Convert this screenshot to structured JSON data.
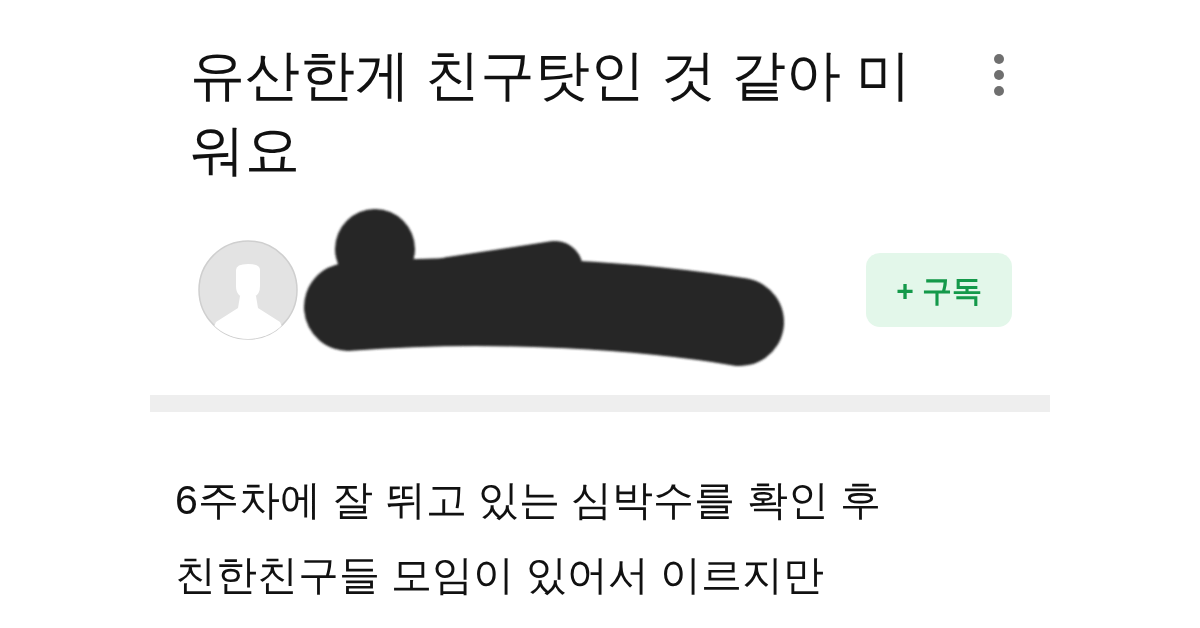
{
  "post": {
    "title": "유산한게 친구탓인 것 같아 미워요"
  },
  "author": {
    "subscribe_button": "+ 구독"
  },
  "body": {
    "lines": [
      "6주차에 잘 뛰고 있는 심박수를 확인 후",
      "친한친구들 모임이 있어서 이르지만"
    ]
  }
}
